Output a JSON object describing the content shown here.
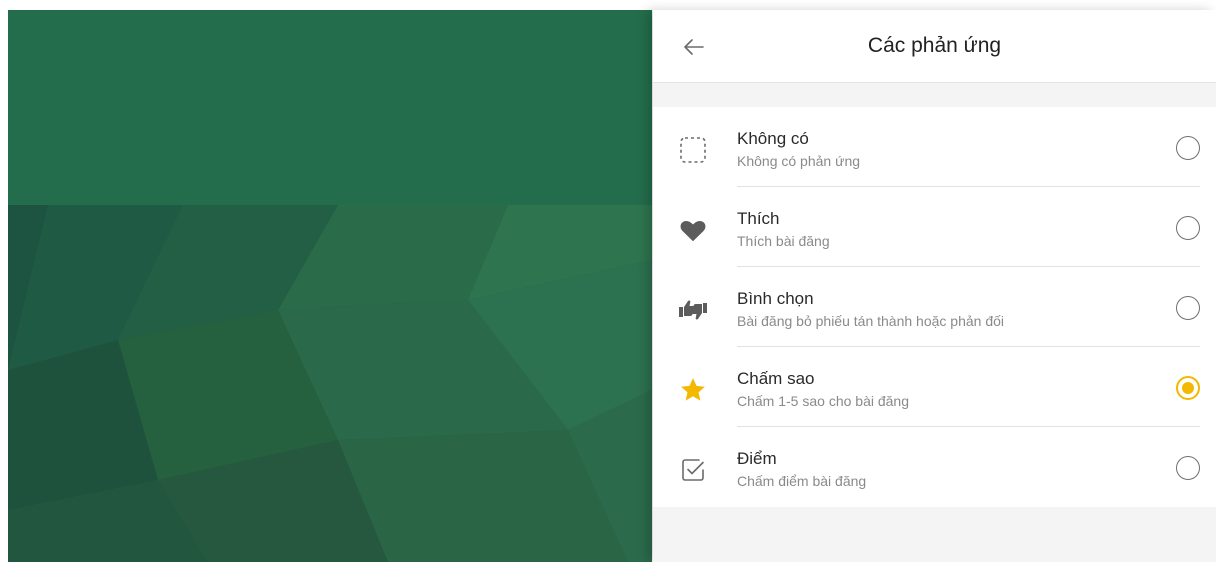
{
  "panel": {
    "title": "Các phản ứng",
    "back_icon": "arrow-left-icon"
  },
  "colors": {
    "accent": "#f5b800",
    "background_green": "#226a4b",
    "icon_gray": "#6b6b6b"
  },
  "reactions": [
    {
      "label": "Không có",
      "description": "Không có phản ứng",
      "icon": "dashed-square-icon",
      "selected": false
    },
    {
      "label": "Thích",
      "description": "Thích bài đăng",
      "icon": "heart-icon",
      "selected": false
    },
    {
      "label": "Bình chọn",
      "description": "Bài đăng bỏ phiếu tán thành hoặc phản đối",
      "icon": "vote-thumbs-icon",
      "selected": false
    },
    {
      "label": "Chấm sao",
      "description": "Chấm 1-5 sao cho bài đăng",
      "icon": "star-icon",
      "selected": true
    },
    {
      "label": "Điểm",
      "description": "Chấm điểm bài đăng",
      "icon": "checkbox-icon",
      "selected": false
    }
  ]
}
